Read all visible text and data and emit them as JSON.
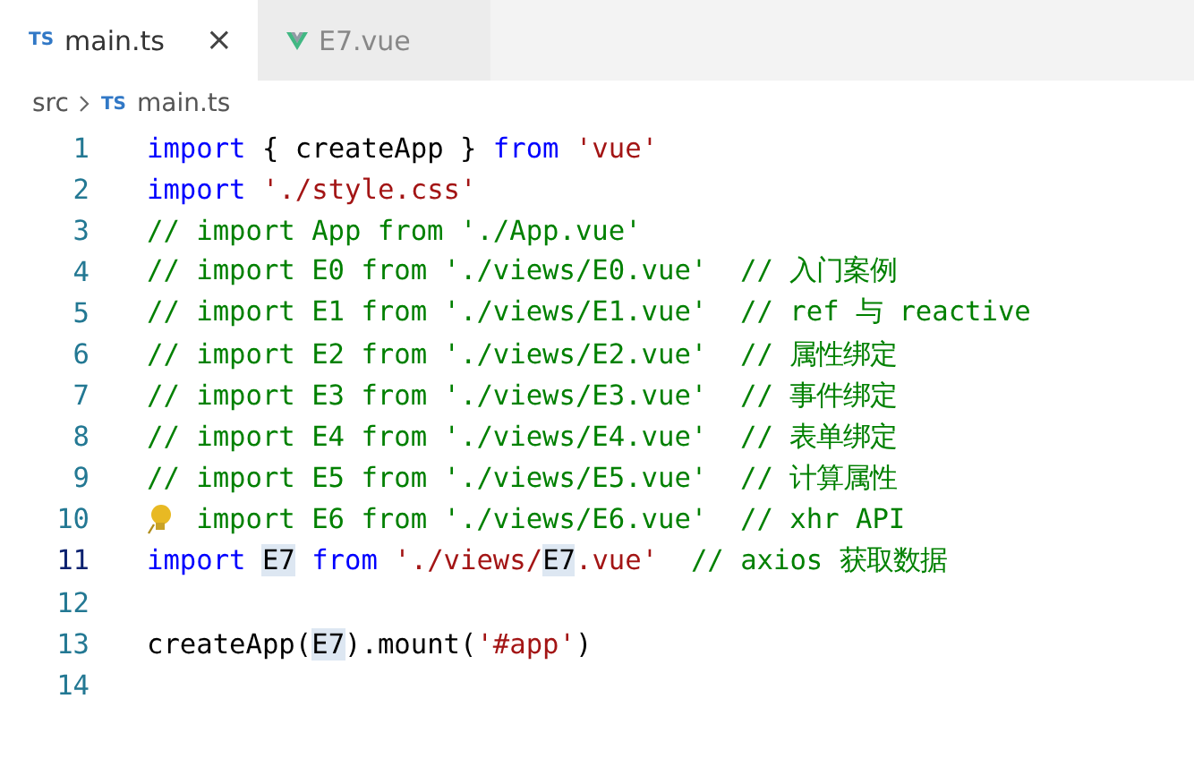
{
  "tabs": [
    {
      "icon": "TS",
      "kind": "ts",
      "label": "main.ts",
      "selected": true,
      "close": "×"
    },
    {
      "kind": "vue",
      "label": "E7.vue",
      "selected": false
    }
  ],
  "breadcrumb": {
    "folder": "src",
    "file_icon": "TS",
    "file": "main.ts"
  },
  "lines": [
    {
      "number": "1",
      "current": false,
      "tokens": [
        {
          "kind": "keyword",
          "text": "import"
        },
        {
          "kind": "plain",
          "text": " { createApp } "
        },
        {
          "kind": "keyword",
          "text": "from"
        },
        {
          "kind": "string",
          "text": " 'vue'"
        }
      ]
    },
    {
      "number": "2",
      "current": false,
      "tokens": [
        {
          "kind": "keyword",
          "text": "import"
        },
        {
          "kind": "string",
          "text": " './style.css'"
        }
      ]
    },
    {
      "number": "3",
      "current": false,
      "tokens": [
        {
          "kind": "comment",
          "text": "// import App from './App.vue'"
        }
      ]
    },
    {
      "number": "4",
      "current": false,
      "tokens": [
        {
          "kind": "comment",
          "text": "// import E0 from './views/E0.vue'  // 入门案例"
        }
      ]
    },
    {
      "number": "5",
      "current": false,
      "tokens": [
        {
          "kind": "comment",
          "text": "// import E1 from './views/E1.vue'  // ref 与 reactive"
        }
      ]
    },
    {
      "number": "6",
      "current": false,
      "tokens": [
        {
          "kind": "comment",
          "text": "// import E2 from './views/E2.vue'  // 属性绑定"
        }
      ]
    },
    {
      "number": "7",
      "current": false,
      "tokens": [
        {
          "kind": "comment",
          "text": "// import E3 from './views/E3.vue'  // 事件绑定"
        }
      ]
    },
    {
      "number": "8",
      "current": false,
      "tokens": [
        {
          "kind": "comment",
          "text": "// import E4 from './views/E4.vue'  // 表单绑定"
        }
      ]
    },
    {
      "number": "9",
      "current": false,
      "tokens": [
        {
          "kind": "comment",
          "text": "// import E5 from './views/E5.vue'  // 计算属性"
        }
      ]
    },
    {
      "number": "10",
      "current": false,
      "lightbulb": true,
      "tokens": [
        {
          "kind": "comment",
          "text": "import E6 from './views/E6.vue'  // xhr API"
        }
      ]
    },
    {
      "number": "11",
      "current": true,
      "tokens": [
        {
          "kind": "keyword",
          "text": "import "
        },
        {
          "kind": "match",
          "text": "E7"
        },
        {
          "kind": "keyword",
          "text": " from"
        },
        {
          "kind": "string",
          "text": " './views/"
        },
        {
          "kind": "match",
          "text": "E7"
        },
        {
          "kind": "string",
          "text": ".vue'"
        },
        {
          "kind": "comment",
          "text": "  // axios 获取数据"
        }
      ]
    },
    {
      "number": "12",
      "current": false
    },
    {
      "number": "13",
      "current": false,
      "tokens": [
        {
          "kind": "plain",
          "text": "createApp("
        },
        {
          "kind": "match",
          "text": "E7"
        },
        {
          "kind": "plain",
          "text": ").mount("
        },
        {
          "kind": "string",
          "text": "'#app'"
        },
        {
          "kind": "plain",
          "text": ")"
        }
      ]
    },
    {
      "number": "14",
      "current": false
    }
  ]
}
